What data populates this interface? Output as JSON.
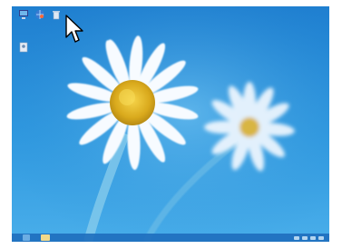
{
  "desktop": {
    "wallpaper_subject": "",
    "icons": [
      {
        "name": "this-pc-icon",
        "label": ""
      },
      {
        "name": "network-icon",
        "label": ""
      },
      {
        "name": "recycle-bin-icon",
        "label": ""
      },
      {
        "name": "user-files-icon",
        "label": ""
      }
    ]
  },
  "taskbar": {
    "start_label": "",
    "explorer_label": ""
  },
  "colors": {
    "sky_top": "#1f86d6",
    "sky_bottom": "#49aeea",
    "taskbar": "#1e6ebe",
    "petal": "#f7fbff",
    "center": "#e7c22e"
  }
}
